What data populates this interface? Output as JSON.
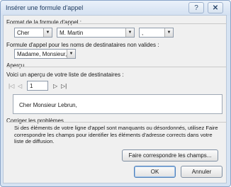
{
  "window": {
    "title": "Insérer une formule d'appel",
    "help_icon": "?",
    "close_icon": "✕"
  },
  "greeting": {
    "section_label": "Format de la formule d'appel :",
    "salutation": "Cher",
    "name_format": "M. Martin",
    "punctuation": ","
  },
  "invalid": {
    "label": "Formule d'appel pour les noms de destinataires non valides :",
    "value": "Madame, Monsieur,"
  },
  "preview": {
    "section_label": "Aperçu",
    "instruction": "Voici un aperçu de votre liste de destinataires :",
    "record_number": "1",
    "text": "Cher Monsieur Lebrun,"
  },
  "problems": {
    "section_label": "Corriger les problèmes",
    "description": "Si des éléments de votre ligne d'appel sont manquants ou désordonnés, utilisez Faire correspondre les champs pour identifier les éléments d'adresse corrects dans votre liste de diffusion.",
    "match_button": "Faire correspondre les champs..."
  },
  "footer": {
    "ok_label": "OK",
    "cancel_label": "Annuler"
  },
  "nav_icons": {
    "first": "|◁",
    "prev": "◁",
    "next": "▷",
    "last": "▷|"
  },
  "dropdown_arrow": "▼"
}
